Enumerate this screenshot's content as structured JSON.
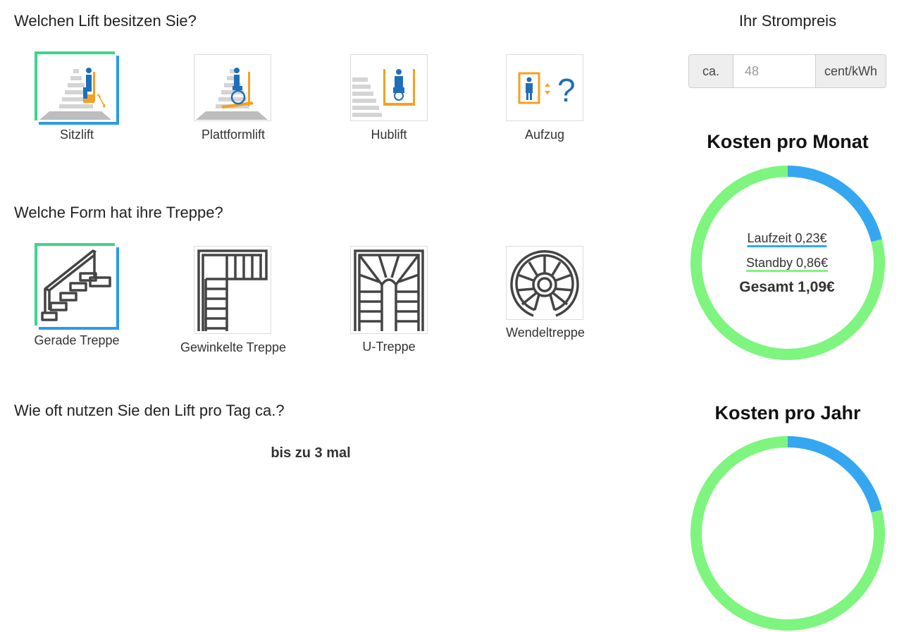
{
  "questions": {
    "lift_type": "Welchen Lift besitzen Sie?",
    "stair_shape": "Welche Form hat ihre Treppe?",
    "usage": "Wie oft nutzen Sie den Lift pro Tag ca.?"
  },
  "lift_options": [
    {
      "label": "Sitzlift",
      "icon": "stair-chair-lift-icon",
      "selected": true
    },
    {
      "label": "Plattformlift",
      "icon": "platform-lift-icon",
      "selected": false
    },
    {
      "label": "Hublift",
      "icon": "vertical-lift-icon",
      "selected": false
    },
    {
      "label": "Aufzug",
      "icon": "elevator-question-icon",
      "selected": false
    }
  ],
  "stair_options": [
    {
      "label": "Gerade Treppe",
      "icon": "straight-stairs-icon",
      "selected": true
    },
    {
      "label": "Gewinkelte Treppe",
      "icon": "angled-stairs-icon",
      "selected": false
    },
    {
      "label": "U-Treppe",
      "icon": "u-stairs-icon",
      "selected": false
    },
    {
      "label": "Wendeltreppe",
      "icon": "spiral-stairs-icon",
      "selected": false
    }
  ],
  "usage": {
    "value": "bis zu 3 mal"
  },
  "price": {
    "title": "Ihr Strompreis",
    "prefix": "ca.",
    "placeholder": "48",
    "suffix": "cent/kWh"
  },
  "monthly": {
    "title": "Kosten pro Monat",
    "runtime_label": "Laufzeit 0,23€",
    "standby_label": "Standby 0,86€",
    "total_label": "Gesamt 1,09€"
  },
  "yearly": {
    "title": "Kosten pro Jahr"
  },
  "colors": {
    "runtime": "#35a7f0",
    "standby": "#7ef57e",
    "select_top": "#3cd68a",
    "select_bottom": "#2b9be6",
    "icon_orange": "#f5a020",
    "icon_blue": "#1e6fb8"
  },
  "chart_data": [
    {
      "type": "pie",
      "title": "Kosten pro Monat",
      "categories": [
        "Laufzeit",
        "Standby"
      ],
      "values": [
        0.23,
        0.86
      ]
    },
    {
      "type": "pie",
      "title": "Kosten pro Jahr",
      "categories": [
        "Laufzeit",
        "Standby"
      ],
      "values": [
        0.23,
        0.86
      ]
    }
  ]
}
